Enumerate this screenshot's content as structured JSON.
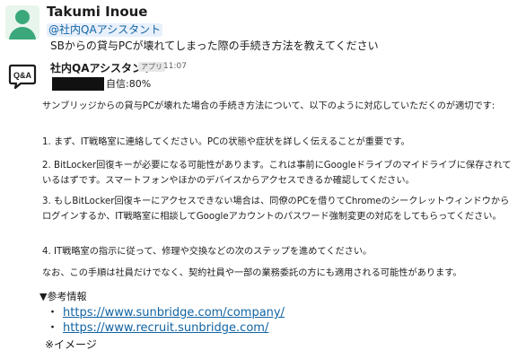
{
  "user": {
    "name": "Takumi Inoue",
    "mention": "@社内QAアシスタント",
    "question": "SBからの貸与PCが壊れてしまった際の手続き方法を教えてください"
  },
  "bot": {
    "avatar_text": "Q&A",
    "name": "社内QAアシスタント",
    "badge": "アプリ",
    "time": "11:07",
    "confidence": "自信:80%",
    "paragraphs": [
      "サンブリッジからの貸与PCが壊れた場合の手続き方法について、以下のように対応していただくのが適切です:",
      "1. まず、IT戦略室に連絡してください。PCの状態や症状を詳しく伝えることが重要です。",
      "2. BitLocker回復キーが必要になる可能性があります。これは事前にGoogleドライブのマイドライブに保存されているはずです。スマートフォンやほかのデバイスからアクセスできるか確認してください。",
      "3. もしBitLocker回復キーにアクセスできない場合は、同僚のPCを借りてChromeのシークレットウィンドウからログインするか、IT戦略室に相談してGoogleアカウントのパスワード強制変更の対応をしてもらってください。",
      "4. IT戦略室の指示に従って、修理や交換などの次のステップを進めてください。",
      "なお、この手順は社員だけでなく、契約社員や一部の業務委託の方にも適用される可能性があります。"
    ],
    "refs_heading": "▼参考情報",
    "refs": [
      {
        "bullet": "・",
        "url": "https://www.sunbridge.com/company/"
      },
      {
        "bullet": "・",
        "url": "https://www.recruit.sunbridge.com/"
      }
    ],
    "note": "※イメージ"
  },
  "colors": {
    "link": "#1264a3",
    "avatar_green": "#3aa87a",
    "bot_icon": "#1d1c1d"
  }
}
